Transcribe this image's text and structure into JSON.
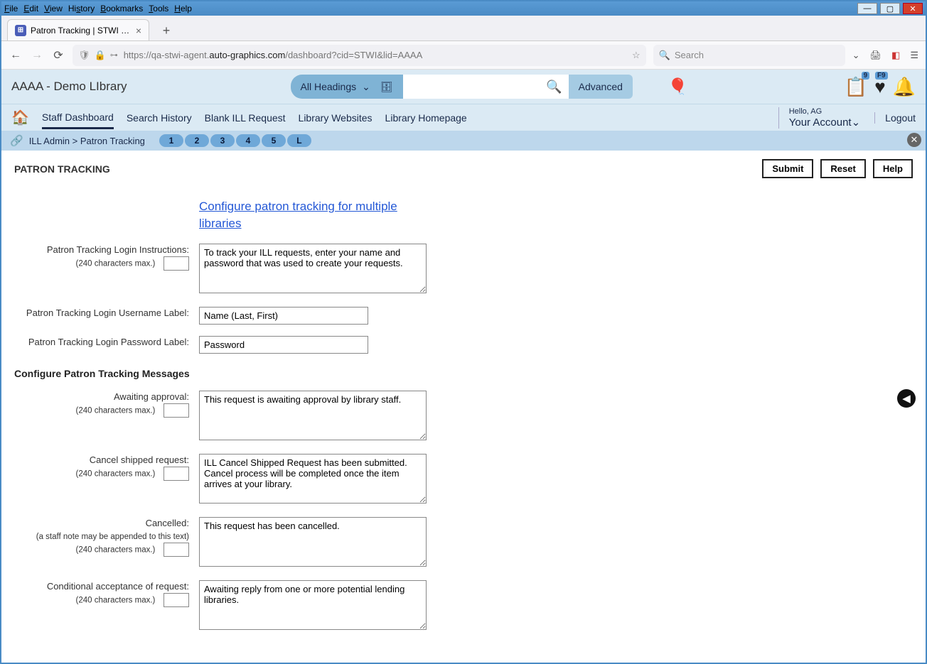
{
  "os_menu": [
    "File",
    "Edit",
    "View",
    "History",
    "Bookmarks",
    "Tools",
    "Help"
  ],
  "tab": {
    "title": "Patron Tracking | STWI | aaaa | A"
  },
  "url": {
    "prefix": "https://qa-stwi-agent.",
    "domain": "auto-graphics.com",
    "path": "/dashboard?cid=STWI&lid=AAAA"
  },
  "browser_search_placeholder": "Search",
  "library_name": "AAAA - Demo LIbrary",
  "search_type": "All Headings",
  "advanced": "Advanced",
  "badges": {
    "list": "9",
    "fav": "F9"
  },
  "nav": {
    "items": [
      "Staff Dashboard",
      "Search History",
      "Blank ILL Request",
      "Library Websites",
      "Library Homepage"
    ],
    "hello": "Hello, AG",
    "account": "Your Account",
    "logout": "Logout"
  },
  "breadcrumb": {
    "admin": "ILL Admin",
    "page": "Patron Tracking",
    "pills": [
      "1",
      "2",
      "3",
      "4",
      "5",
      "L"
    ]
  },
  "content": {
    "title": "PATRON TRACKING",
    "buttons": {
      "submit": "Submit",
      "reset": "Reset",
      "help": "Help"
    },
    "config_link": "Configure patron tracking for multiple libraries",
    "fields": {
      "login_instructions": {
        "label": "Patron Tracking Login Instructions:",
        "sub": "(240 characters max.)",
        "value": "To track your ILL requests, enter your name and password that was used to create your requests."
      },
      "username_label": {
        "label": "Patron Tracking Login Username Label:",
        "value": "Name (Last, First)"
      },
      "password_label": {
        "label": "Patron Tracking Login Password Label:",
        "value": "Password"
      },
      "section": "Configure Patron Tracking Messages",
      "awaiting": {
        "label": "Awaiting approval:",
        "sub": "(240 characters max.)",
        "value": "This request is awaiting approval by library staff."
      },
      "cancel_shipped": {
        "label": "Cancel shipped request:",
        "sub": "(240 characters max.)",
        "value": "ILL Cancel Shipped Request has been submitted. Cancel process will be completed once the item arrives at your library."
      },
      "cancelled": {
        "label": "Cancelled:",
        "sub1": "(a staff note may be appended to this text)",
        "sub2": "(240 characters max.)",
        "value": "This request has been cancelled."
      },
      "conditional": {
        "label": "Conditional acceptance of request:",
        "sub": "(240 characters max.)",
        "value": "Awaiting reply from one or more potential lending libraries."
      }
    }
  }
}
